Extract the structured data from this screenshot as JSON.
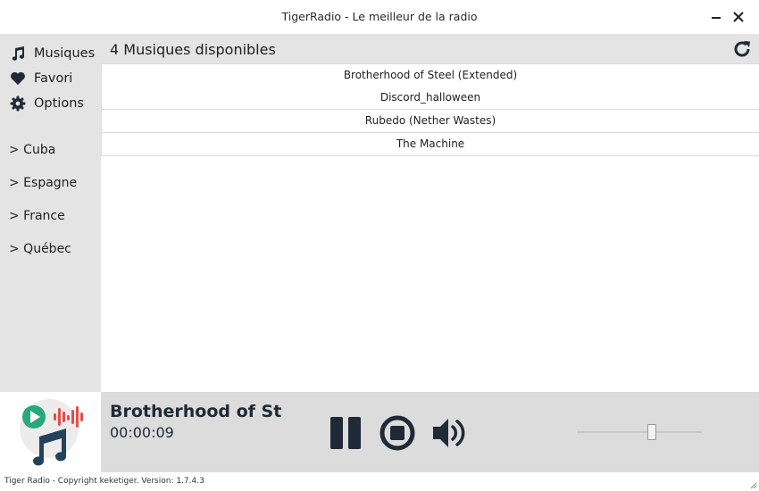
{
  "window": {
    "title": "TigerRadio - Le meilleur de la radio"
  },
  "sidebar": {
    "nav": [
      {
        "label": "Musiques",
        "icon": "music-icon"
      },
      {
        "label": "Favori",
        "icon": "heart-icon"
      },
      {
        "label": "Options",
        "icon": "gear-icon"
      }
    ],
    "countries": [
      "> Cuba",
      "> Espagne",
      "> France",
      "> Québec"
    ]
  },
  "main": {
    "count_label": "4 Musiques disponibles",
    "songs": [
      "Brotherhood of Steel (Extended)",
      "Discord_halloween",
      "Rubedo (Nether Wastes)",
      "The Machine"
    ]
  },
  "player": {
    "now_playing": "Brotherhood of Steel (Extended)",
    "elapsed": "00:00:09",
    "volume": 0.61
  },
  "footer": {
    "text": "Tiger Radio - Copyright keketiger. Version: 1.7.4.3"
  },
  "colors": {
    "sidebar_bg": "#e4e4e4",
    "player_bg": "#dcdcdc",
    "icon_dark": "#1f2a36",
    "logo_green": "#27a979",
    "logo_red": "#e0504a",
    "logo_blue": "#24425c"
  }
}
